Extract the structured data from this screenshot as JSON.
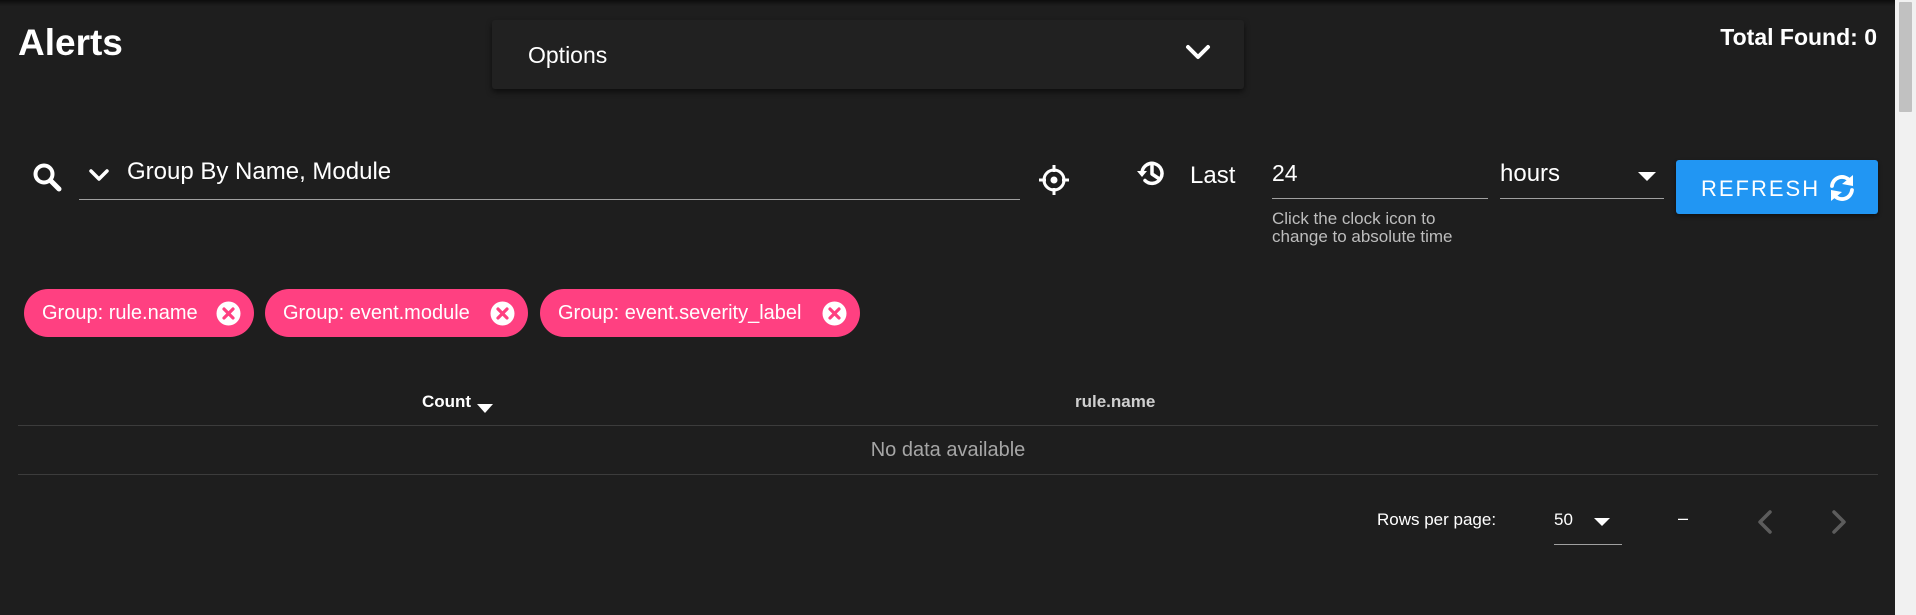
{
  "page": {
    "title": "Alerts",
    "total_found": "Total Found: 0"
  },
  "options": {
    "label": "Options"
  },
  "query": {
    "group_by": "Group By Name, Module",
    "time_prefix": "Last",
    "time_value": "24",
    "time_unit": "hours",
    "hint": "Click the clock icon to change to absolute time",
    "refresh_label": "REFRESH"
  },
  "chips": [
    {
      "label": "Group: rule.name"
    },
    {
      "label": "Group: event.module"
    },
    {
      "label": "Group: event.severity_label"
    }
  ],
  "table": {
    "columns": [
      {
        "label": "Count"
      },
      {
        "label": "rule.name"
      }
    ],
    "empty_text": "No data available"
  },
  "pagination": {
    "rows_per_page_label": "Rows per page:",
    "rows_per_page": "50",
    "range": "–"
  },
  "colors": {
    "background": "#1e1e1e",
    "accent": "#2196f3",
    "chip": "#ff4081"
  },
  "icons": {
    "options_toggle": "chevron-down-icon",
    "search": "search-icon",
    "target": "crosshair-icon",
    "history": "history-icon",
    "refresh": "refresh-icon",
    "chip_remove": "close-circle-icon",
    "prev": "chevron-left-icon",
    "next": "chevron-right-icon"
  }
}
